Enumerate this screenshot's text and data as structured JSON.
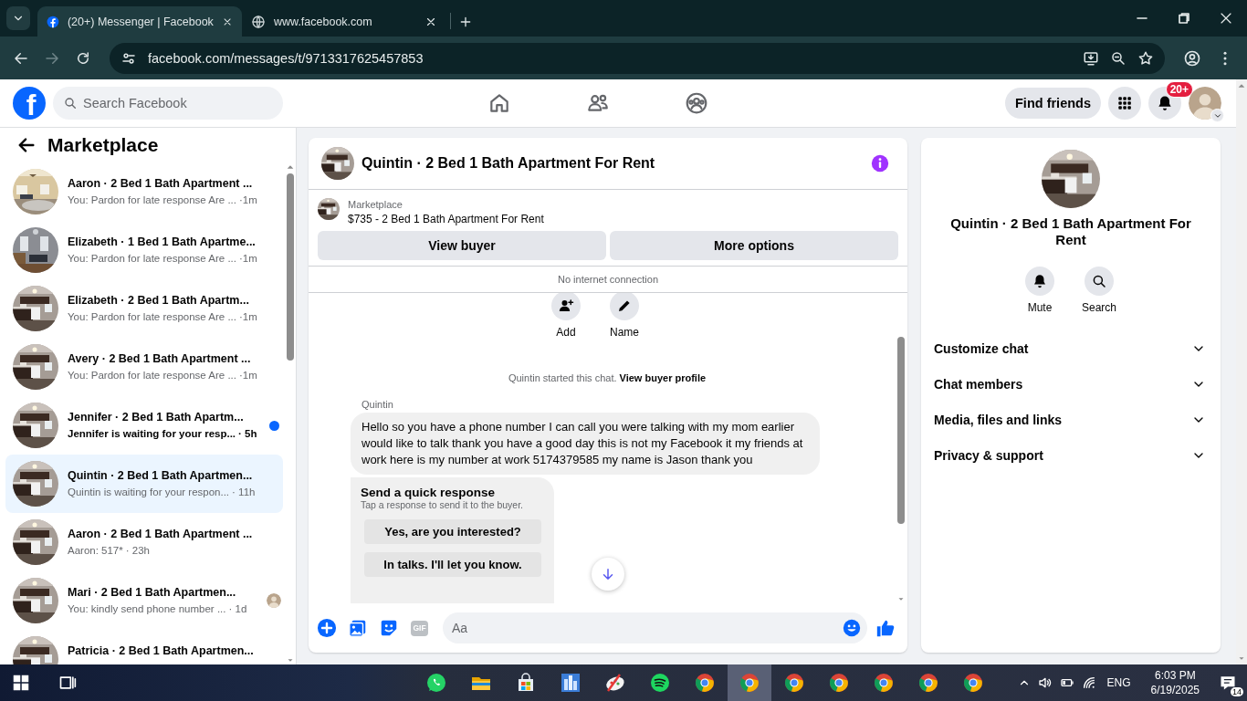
{
  "browser": {
    "tabs": [
      {
        "title": "(20+) Messenger | Facebook",
        "kind": "facebook",
        "selected": true
      },
      {
        "title": "www.facebook.com",
        "kind": "globe",
        "selected": false
      }
    ],
    "url": "facebook.com/messages/t/9713317625457853"
  },
  "topbar": {
    "logo": "f",
    "search_placeholder": "Search Facebook",
    "find_friends": "Find friends",
    "notification_badge": "20+"
  },
  "sidebar": {
    "title": "Marketplace",
    "conversations": [
      {
        "title": "Aaron · 2 Bed 1 Bath Apartment ...",
        "preview": "You: Pardon for late response Are ...",
        "time": "·1m",
        "unread": false,
        "selected": false,
        "seen_avatar": false
      },
      {
        "title": "Elizabeth · 1 Bed 1 Bath Apartme...",
        "preview": "You: Pardon for late response Are ...",
        "time": "·1m",
        "unread": false,
        "selected": false,
        "seen_avatar": false
      },
      {
        "title": "Elizabeth · 2 Bed 1 Bath Apartm...",
        "preview": "You: Pardon for late response Are ...",
        "time": "·1m",
        "unread": false,
        "selected": false,
        "seen_avatar": false
      },
      {
        "title": "Avery · 2 Bed 1 Bath Apartment ...",
        "preview": "You: Pardon for late response Are ...",
        "time": "·1m",
        "unread": false,
        "selected": false,
        "seen_avatar": false
      },
      {
        "title": "Jennifer · 2 Bed 1 Bath Apartm...",
        "preview": "Jennifer is waiting for your resp...",
        "time": "· 5h",
        "unread": true,
        "selected": false,
        "seen_avatar": false
      },
      {
        "title": "Quintin · 2 Bed 1 Bath Apartmen...",
        "preview": "Quintin is waiting for your respon...",
        "time": "· 11h",
        "unread": false,
        "selected": true,
        "seen_avatar": false
      },
      {
        "title": "Aaron · 2 Bed 1 Bath Apartment ...",
        "preview": "Aaron: 517*",
        "time": "· 23h",
        "unread": false,
        "selected": false,
        "seen_avatar": false
      },
      {
        "title": "Mari · 2 Bed 1 Bath Apartmen...",
        "preview": "You: kindly send phone number ...",
        "time": "· 1d",
        "unread": false,
        "selected": false,
        "seen_avatar": true
      },
      {
        "title": "Patricia · 2 Bed 1 Bath Apartmen..."
      }
    ]
  },
  "chat": {
    "title": "Quintin · 2 Bed 1 Bath Apartment For Rent",
    "listing": {
      "label": "Marketplace",
      "title": "$735 - 2 Bed 1 Bath Apartment For Rent"
    },
    "buttons": [
      "View buyer",
      "More options"
    ],
    "notice": "No internet connection",
    "actions": [
      {
        "label": "Add",
        "kind": "add-person"
      },
      {
        "label": "Name",
        "kind": "edit"
      }
    ],
    "system_message": {
      "text": "Quintin started this chat.",
      "link": "View buyer profile"
    },
    "sender": "Quintin",
    "message": "Hello so you have a phone number I can call you were talking with my mom earlier would like to talk thank you have a good day this is not my Facebook it my friends at work here is my number at work  5174379585 my name is Jason thank you",
    "quick_response": {
      "title": "Send a quick response",
      "subtitle": "Tap a response to send it to the buyer.",
      "options": [
        "Yes, are you interested?",
        "In talks. I'll let you know."
      ]
    },
    "composer": {
      "gif": "GIF",
      "placeholder": "Aa"
    }
  },
  "details": {
    "title": "Quintin · 2 Bed 1 Bath Apartment For Rent",
    "actions": [
      {
        "label": "Mute",
        "kind": "bell"
      },
      {
        "label": "Search",
        "kind": "search"
      }
    ],
    "sections": [
      {
        "label": "Customize chat",
        "expanded": false
      },
      {
        "label": "Chat members",
        "expanded": false
      },
      {
        "label": "Media, files and links",
        "expanded": false
      },
      {
        "label": "Privacy & support",
        "expanded": false
      }
    ]
  },
  "taskbar": {
    "apps": [
      {
        "kind": "whatsapp",
        "active": false
      },
      {
        "kind": "folder",
        "active": false
      },
      {
        "kind": "store",
        "active": false
      },
      {
        "kind": "city",
        "active": false
      },
      {
        "kind": "paint",
        "active": false
      },
      {
        "kind": "spotify",
        "active": false
      },
      {
        "kind": "chrome",
        "active": false
      },
      {
        "kind": "chrome",
        "active": true
      },
      {
        "kind": "chrome",
        "active": false
      },
      {
        "kind": "chrome",
        "active": false
      },
      {
        "kind": "chrome",
        "active": false
      },
      {
        "kind": "chrome",
        "active": false
      },
      {
        "kind": "chrome",
        "active": false
      }
    ],
    "language": "ENG",
    "time": "6:03 PM",
    "date": "6/19/2025",
    "notifications": "14"
  }
}
